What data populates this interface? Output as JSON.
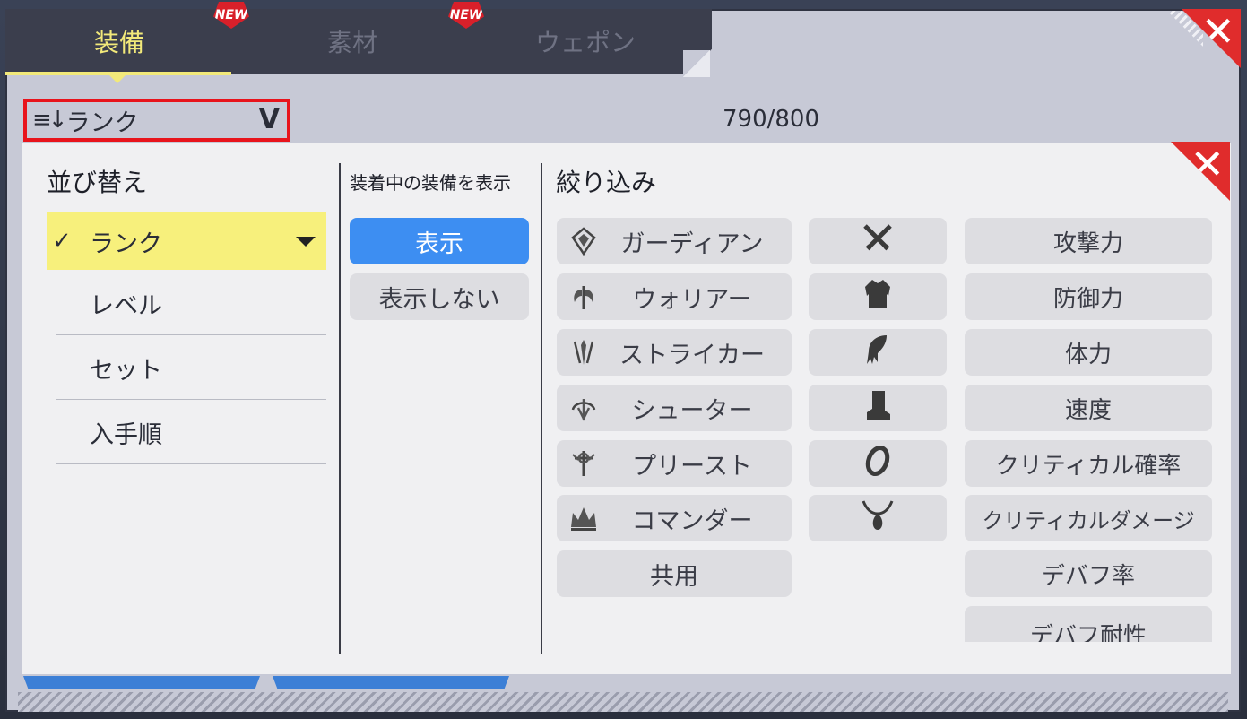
{
  "tabs": [
    {
      "label": "装備",
      "active": true,
      "new": true
    },
    {
      "label": "素材",
      "active": false,
      "new": true
    },
    {
      "label": "ウェポン",
      "active": false,
      "new": false
    }
  ],
  "new_badge": "NEW",
  "sort_dropdown": {
    "icon": "sort-descending-icon",
    "label": "ランク"
  },
  "inventory_count": "790/800",
  "sort_section": {
    "title": "並び替え",
    "options": [
      {
        "label": "ランク",
        "selected": true
      },
      {
        "label": "レベル",
        "selected": false
      },
      {
        "label": "セット",
        "selected": false
      },
      {
        "label": "入手順",
        "selected": false
      }
    ]
  },
  "equipped_section": {
    "title": "装着中の装備を表示",
    "options": [
      {
        "label": "表示",
        "selected": true
      },
      {
        "label": "表示しない",
        "selected": false
      }
    ]
  },
  "filter_section": {
    "title": "絞り込み",
    "classes": [
      {
        "label": "ガーディアン",
        "icon": "guardian-icon"
      },
      {
        "label": "ウォリアー",
        "icon": "warrior-icon"
      },
      {
        "label": "ストライカー",
        "icon": "striker-icon"
      },
      {
        "label": "シューター",
        "icon": "shooter-icon"
      },
      {
        "label": "プリースト",
        "icon": "priest-icon"
      },
      {
        "label": "コマンダー",
        "icon": "commander-icon"
      },
      {
        "label": "共用",
        "icon": ""
      }
    ],
    "slots": [
      {
        "icon": "weapon-icon"
      },
      {
        "icon": "armor-icon"
      },
      {
        "icon": "gloves-icon"
      },
      {
        "icon": "boots-icon"
      },
      {
        "icon": "ring-icon"
      },
      {
        "icon": "necklace-icon"
      }
    ],
    "stats": [
      {
        "label": "攻撃力"
      },
      {
        "label": "防御力"
      },
      {
        "label": "体力"
      },
      {
        "label": "速度"
      },
      {
        "label": "クリティカル確率"
      },
      {
        "label": "クリティカルダメージ"
      },
      {
        "label": "デバフ率"
      },
      {
        "label": "デバフ耐性"
      }
    ]
  },
  "colors": {
    "tab_active": "#f2e97a",
    "selected_row": "#f7f07c",
    "toggle_on": "#3d8ef2",
    "close": "#e02c2c",
    "highlight_border": "#e8141c"
  }
}
